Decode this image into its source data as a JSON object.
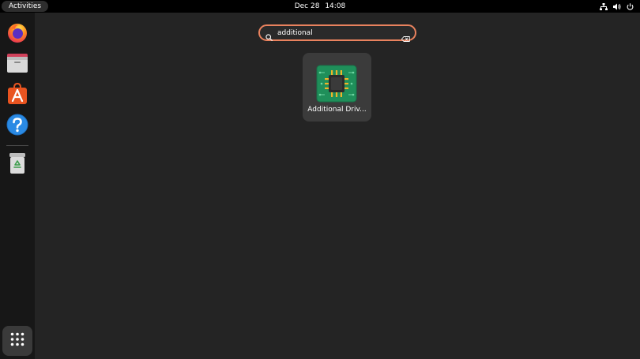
{
  "topbar": {
    "activities_label": "Activities",
    "date": "Dec 28",
    "time": "14:08",
    "tray_icons": [
      "network-icon",
      "volume-icon",
      "power-icon"
    ]
  },
  "dock": {
    "items": [
      {
        "name": "firefox-icon",
        "app": "Firefox"
      },
      {
        "name": "files-icon",
        "app": "Files"
      },
      {
        "name": "app-center-icon",
        "app": "App Center"
      },
      {
        "name": "help-icon",
        "app": "Help"
      },
      {
        "name": "trash-icon",
        "app": "Trash"
      }
    ],
    "apps_grid_icon": "apps-grid-icon"
  },
  "search": {
    "value": "additional",
    "clear_icon": "clear-search-icon"
  },
  "results": [
    {
      "label": "Additional Driv...",
      "icon": "chip-icon"
    }
  ],
  "colors": {
    "background": "#242424",
    "topbar": "#000000",
    "dock": "#171717",
    "accent": "#e9825e",
    "tile": "#3b3b3b"
  }
}
